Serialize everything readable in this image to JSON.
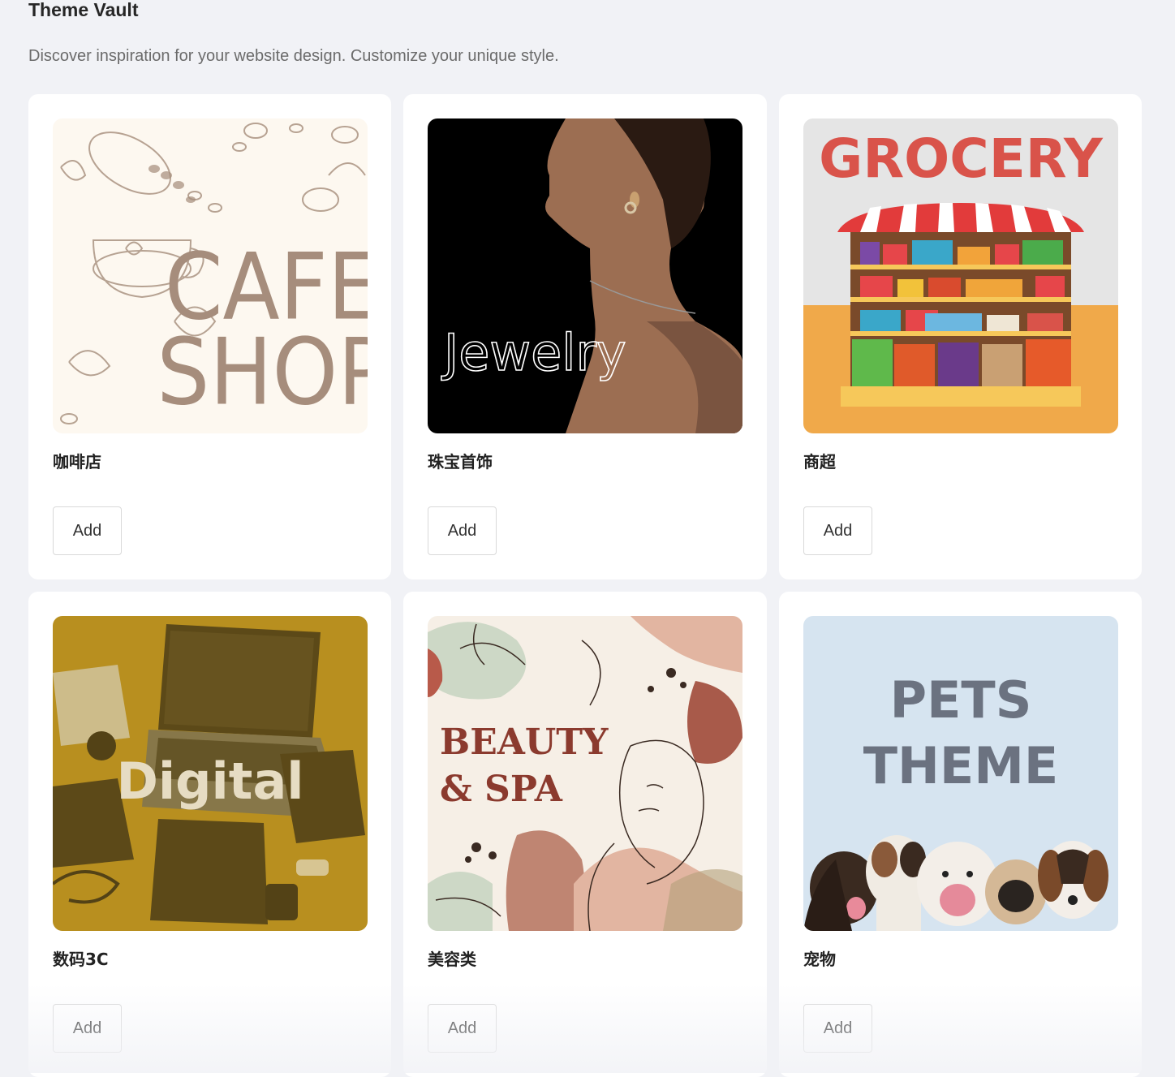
{
  "header": {
    "title": "Theme Vault",
    "subtitle": "Discover inspiration for your website design. Customize your unique style."
  },
  "themes": [
    {
      "name": "咖啡店",
      "image_text": [
        "CAFE",
        "SHOP"
      ],
      "add_label": "Add"
    },
    {
      "name": "珠宝首饰",
      "image_text": [
        "Jewelry"
      ],
      "add_label": "Add"
    },
    {
      "name": "商超",
      "image_text": [
        "GROCERY"
      ],
      "add_label": "Add"
    },
    {
      "name": "数码3C",
      "image_text": [
        "Digital"
      ],
      "add_label": "Add"
    },
    {
      "name": "美容类",
      "image_text": [
        "BEAUTY",
        "& SPA"
      ],
      "add_label": "Add"
    },
    {
      "name": "宠物",
      "image_text": [
        "PETS",
        "THEME"
      ],
      "add_label": "Add"
    }
  ],
  "colors": {
    "page_background": "#f1f2f6",
    "card_background": "#ffffff",
    "grocery_red": "#d9534a",
    "pets_background": "#d6e4f0",
    "beauty_text": "#8b3a2e"
  }
}
